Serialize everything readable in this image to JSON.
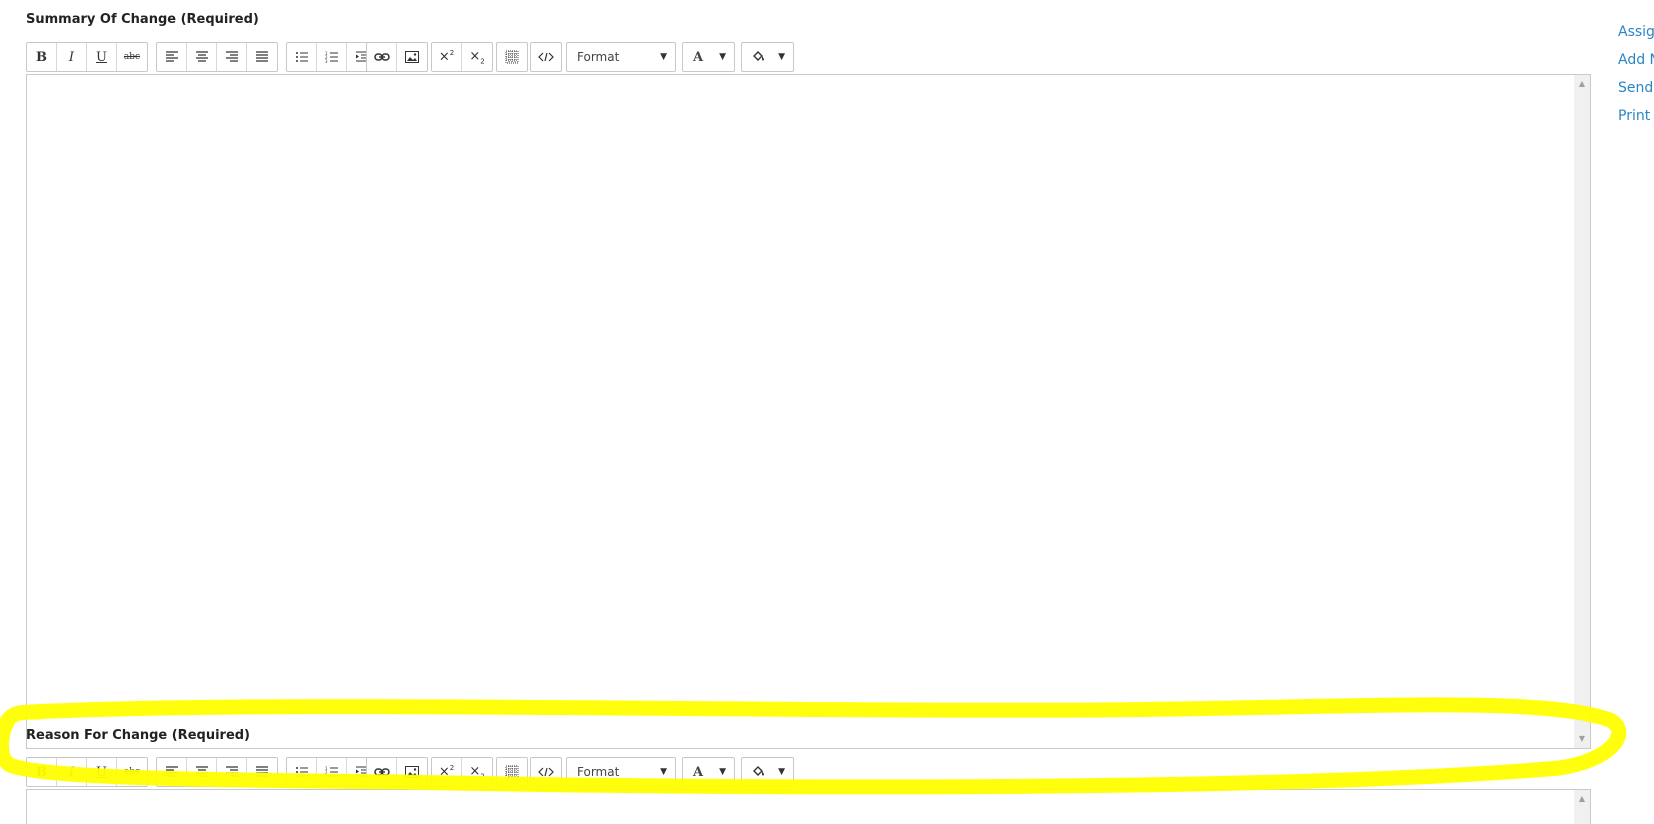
{
  "summary": {
    "label": "Summary Of Change (Required)",
    "format_label": "Format"
  },
  "reason": {
    "label": "Reason For Change (Required)",
    "format_label": "Format"
  },
  "toolbar_text": {
    "bold": "B",
    "italic": "I",
    "underline": "U",
    "strike": "abc",
    "font_color": "A"
  },
  "side_links": [
    "Assig",
    "Add N",
    "Send",
    "Print"
  ],
  "colors": {
    "link": "#2b86c5",
    "highlight": "#ffff00"
  },
  "icons": [
    "bold-icon",
    "italic-icon",
    "underline-icon",
    "strikethrough-icon",
    "align-left-icon",
    "align-center-icon",
    "align-right-icon",
    "align-justify-icon",
    "bullet-list-icon",
    "numbered-list-icon",
    "indent-icon",
    "link-icon",
    "image-icon",
    "superscript-icon",
    "subscript-icon",
    "table-icon",
    "source-code-icon",
    "font-color-icon",
    "background-color-icon",
    "scroll-up-icon",
    "scroll-down-icon"
  ]
}
